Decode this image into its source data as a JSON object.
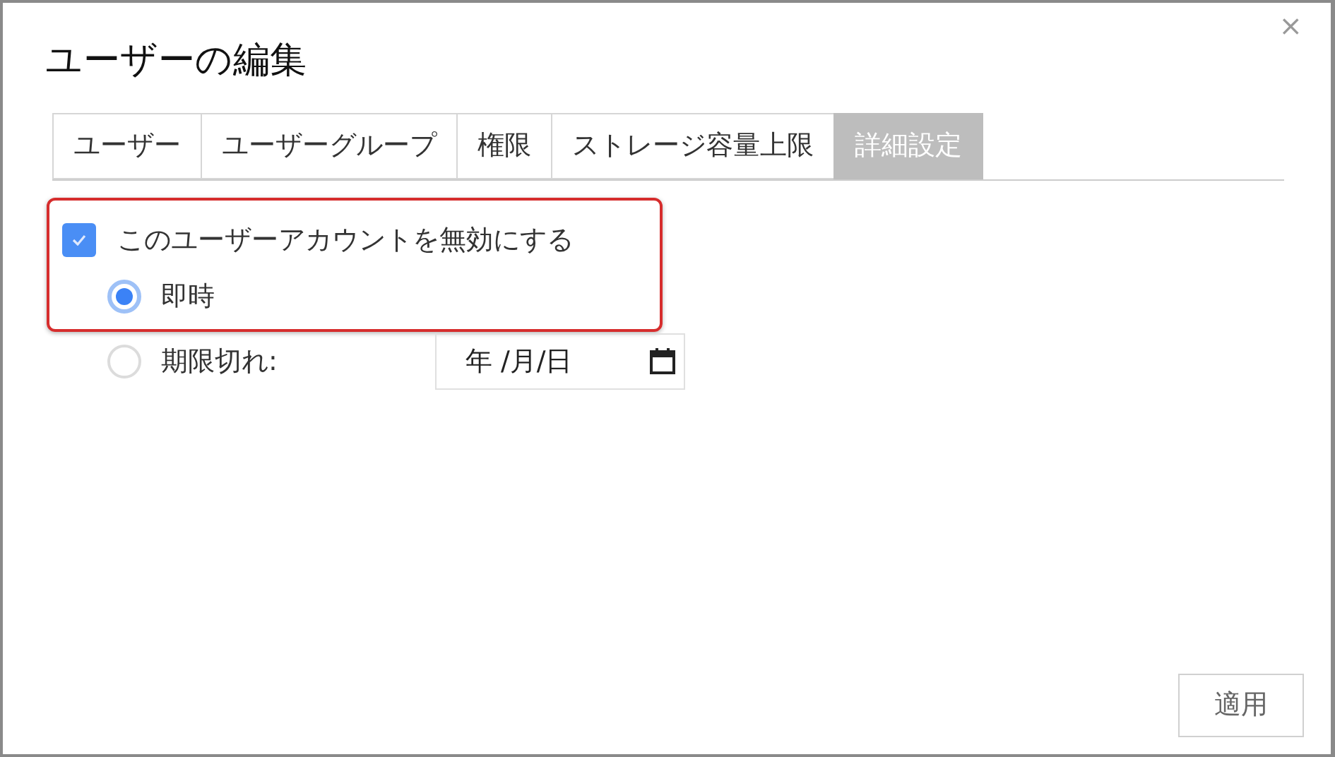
{
  "dialog": {
    "title": "ユーザーの編集",
    "close": "×"
  },
  "tabs": [
    {
      "label": "ユーザー",
      "selected": false
    },
    {
      "label": "ユーザーグループ",
      "selected": false
    },
    {
      "label": "権限",
      "selected": false
    },
    {
      "label": "ストレージ容量上限",
      "selected": false
    },
    {
      "label": "詳細設定",
      "selected": true
    }
  ],
  "disable_account": {
    "label": "このユーザーアカウントを無効にする",
    "checked": true
  },
  "options": [
    {
      "label": "即時",
      "selected": true
    },
    {
      "label": "期限切れ:",
      "selected": false,
      "date": "年 /月/日"
    }
  ],
  "buttons": [
    "適用"
  ]
}
